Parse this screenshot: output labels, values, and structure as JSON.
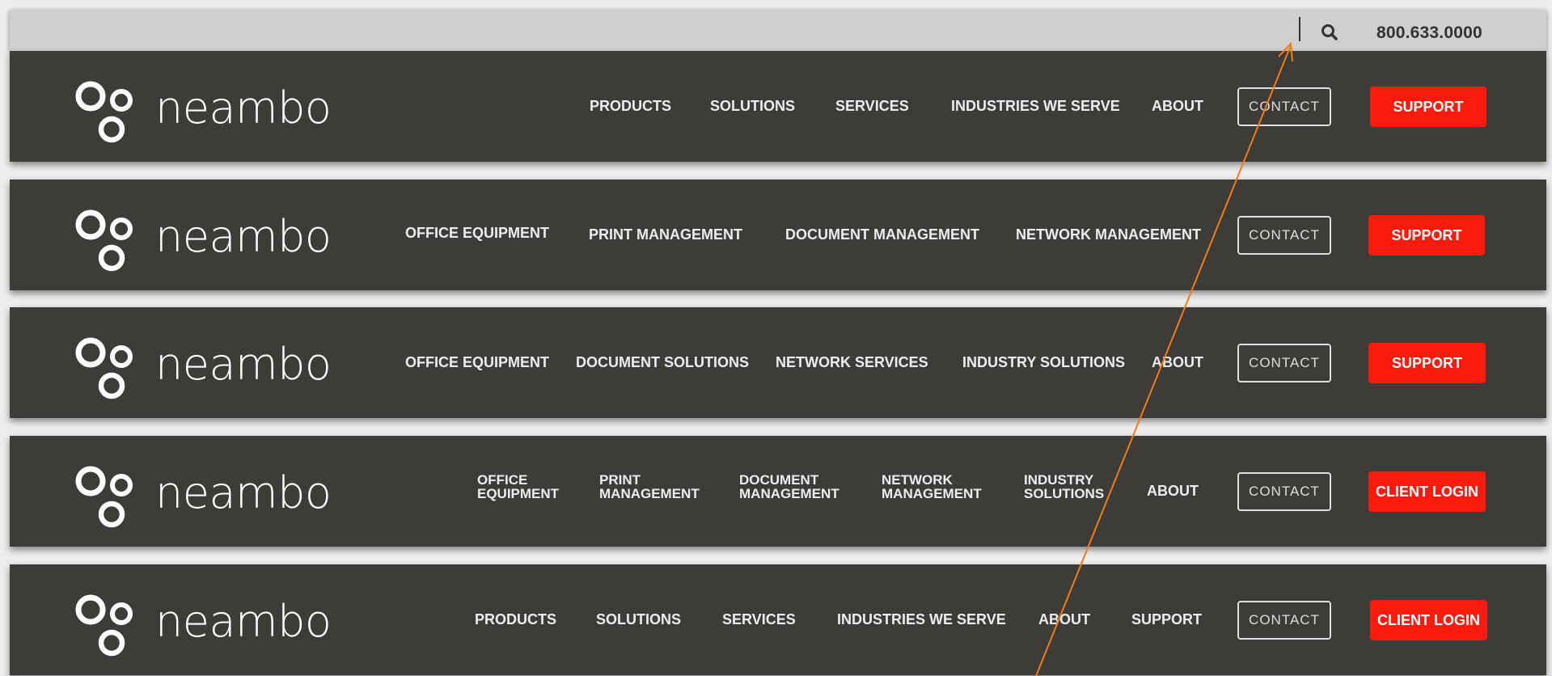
{
  "utility": {
    "phone": "800.633.0000",
    "search_icon": "search-icon"
  },
  "headers": [
    {
      "logo": "neambo",
      "nav": [
        {
          "lines": [
            "PRODUCTS"
          ]
        },
        {
          "lines": [
            "SOLUTIONS"
          ]
        },
        {
          "lines": [
            "SERVICES"
          ]
        },
        {
          "lines": [
            "INDUSTRIES WE SERVE"
          ]
        },
        {
          "lines": [
            "ABOUT"
          ]
        }
      ],
      "contact": "CONTACT",
      "cta": "SUPPORT"
    },
    {
      "logo": "neambo",
      "nav": [
        {
          "lines": [
            "OFFICE EQUIPMENT"
          ]
        },
        {
          "lines": [
            "PRINT  MANAGEMENT"
          ]
        },
        {
          "lines": [
            "DOCUMENT MANAGEMENT"
          ]
        },
        {
          "lines": [
            "NETWORK  MANAGEMENT"
          ]
        }
      ],
      "contact": "CONTACT",
      "cta": "SUPPORT"
    },
    {
      "logo": "neambo",
      "nav": [
        {
          "lines": [
            "OFFICE EQUIPMENT"
          ]
        },
        {
          "lines": [
            "DOCUMENT SOLUTIONS"
          ]
        },
        {
          "lines": [
            "NETWORK SERVICES"
          ]
        },
        {
          "lines": [
            "INDUSTRY SOLUTIONS"
          ]
        },
        {
          "lines": [
            "ABOUT"
          ]
        }
      ],
      "contact": "CONTACT",
      "cta": "SUPPORT"
    },
    {
      "logo": "neambo",
      "nav": [
        {
          "lines": [
            "OFFICE",
            "EQUIPMENT"
          ]
        },
        {
          "lines": [
            "PRINT",
            "MANAGEMENT"
          ]
        },
        {
          "lines": [
            "DOCUMENT",
            "MANAGEMENT"
          ]
        },
        {
          "lines": [
            "NETWORK",
            "MANAGEMENT"
          ]
        },
        {
          "lines": [
            "INDUSTRY",
            "SOLUTIONS"
          ]
        },
        {
          "lines": [
            "ABOUT"
          ]
        }
      ],
      "contact": "CONTACT",
      "cta": "CLIENT LOGIN"
    },
    {
      "logo": "neambo",
      "nav": [
        {
          "lines": [
            "PRODUCTS"
          ]
        },
        {
          "lines": [
            "SOLUTIONS"
          ]
        },
        {
          "lines": [
            "SERVICES"
          ]
        },
        {
          "lines": [
            "INDUSTRIES WE SERVE"
          ]
        },
        {
          "lines": [
            "ABOUT"
          ]
        },
        {
          "lines": [
            "SUPPORT"
          ]
        }
      ],
      "contact": "CONTACT",
      "cta": "CLIENT LOGIN"
    }
  ],
  "colors": {
    "header_bg": "#3d3c38",
    "utility_bg": "#cfcfcf",
    "accent_red": "#fb1a0e",
    "annotation_arrow": "#f07d1a"
  }
}
